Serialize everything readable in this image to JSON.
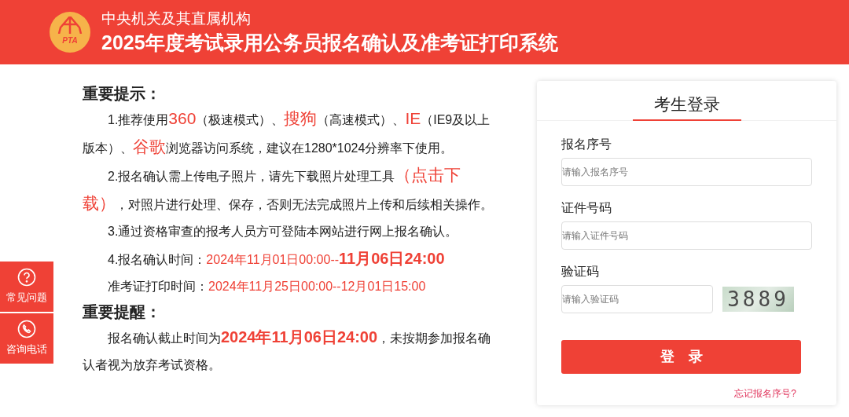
{
  "header": {
    "logo_text": "PTA",
    "subtitle": "中央机关及其直属机构",
    "title": "2025年度考试录用公务员报名确认及准考证打印系统"
  },
  "side_buttons": [
    {
      "kind": "faq",
      "label": "常见问题"
    },
    {
      "kind": "phone",
      "label": "咨询电话"
    }
  ],
  "notice": {
    "heading": "重要提示：",
    "paragraphs": [
      [
        {
          "kind": "text",
          "text": "1.推荐使用"
        },
        {
          "kind": "highlight",
          "text": "360"
        },
        {
          "kind": "text",
          "text": "（极速模式）、"
        },
        {
          "kind": "highlight",
          "text": "搜狗"
        },
        {
          "kind": "text",
          "text": "（高速模式）、"
        },
        {
          "kind": "highlight",
          "text": "IE"
        },
        {
          "kind": "text",
          "text": "（IE9及以上版本）、"
        },
        {
          "kind": "highlight",
          "text": "谷歌"
        },
        {
          "kind": "text",
          "text": "浏览器访问系统，建议在1280*1024分辨率下使用。"
        }
      ],
      [
        {
          "kind": "text",
          "text": "2.报名确认需上传电子照片，请先下载照片处理工具"
        },
        {
          "kind": "highlight",
          "text": "（点击下载）"
        },
        {
          "kind": "text",
          "text": "，对照片进行处理、保存，否则无法完成照片上传和后续相关操作。"
        }
      ],
      [
        {
          "kind": "text",
          "text": "3.通过资格审查的报考人员方可登陆本网站进行网上报名确认。"
        }
      ],
      [
        {
          "kind": "text",
          "text": "4.报名确认时间："
        },
        {
          "kind": "date",
          "text": "2024年11月01日00:00--"
        },
        {
          "kind": "deadline",
          "text": "11月06日24:00"
        }
      ],
      [
        {
          "kind": "text",
          "text": "准考证打印时间："
        },
        {
          "kind": "date",
          "text": "2024年11月25日00:00--12月01日15:00"
        }
      ]
    ]
  },
  "reminder": {
    "heading": "重要提醒：",
    "paragraphs": [
      [
        {
          "kind": "text",
          "text": "报名确认截止时间为"
        },
        {
          "kind": "deadline",
          "text": "2024年11月06日24:00"
        },
        {
          "kind": "text",
          "text": "，未按期参加报名确认者视为放弃考试资格。"
        }
      ]
    ]
  },
  "login": {
    "title": "考生登录",
    "fields": [
      {
        "kind": "text",
        "label": "报名序号",
        "placeholder": "请输入报名序号"
      },
      {
        "kind": "text",
        "label": "证件号码",
        "placeholder": "请输入证件号码"
      },
      {
        "kind": "captcha",
        "label": "验证码",
        "placeholder": "请输入验证码",
        "captcha": "3889"
      }
    ],
    "button": "登　录",
    "forgot_link": "忘记报名序号?"
  }
}
